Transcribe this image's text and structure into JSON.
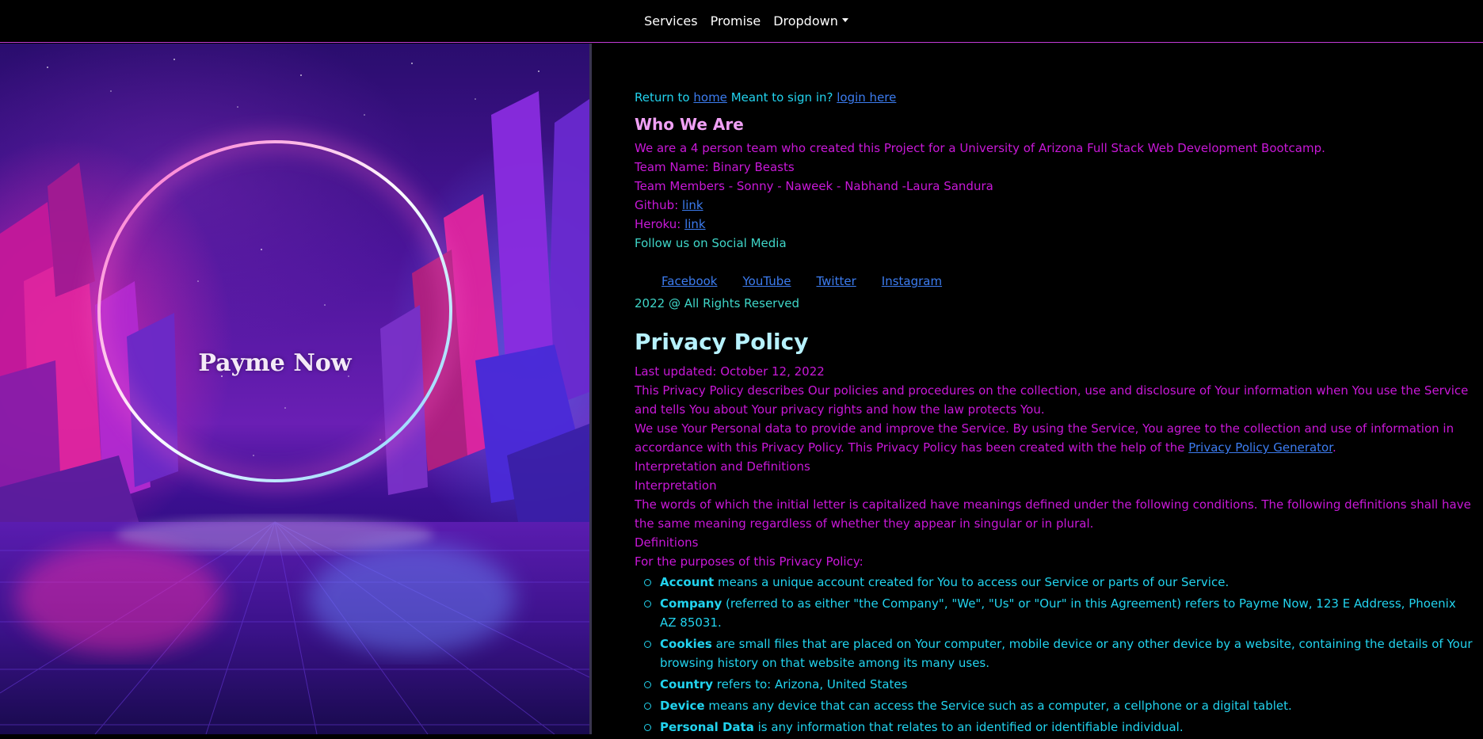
{
  "nav": {
    "items": [
      "Services",
      "Promise",
      "Dropdown"
    ]
  },
  "hero": {
    "title": "Payme Now"
  },
  "intro": {
    "return_to": "Return to",
    "home_link": "home",
    "meant_to": "Meant to sign in?",
    "login_link": "login here"
  },
  "who": {
    "title": "Who We Are",
    "description": "We are a 4 person team who created this Project for a University of Arizona Full Stack Web Development Bootcamp.",
    "team_name": "Team Name: Binary Beasts",
    "team_members": "Team Members - Sonny - Naweek - Nabhand -Laura Sandura",
    "github_label": "Github:",
    "github_link": "link",
    "heroku_label": "Heroku:",
    "heroku_link": "link",
    "follow": "Follow us on Social Media",
    "social": [
      "Facebook",
      "YouTube",
      "Twitter",
      "Instagram"
    ],
    "rights": "2022 @ All Rights Reserved"
  },
  "privacy": {
    "title": "Privacy Policy",
    "last_updated": "Last updated: October 12, 2022",
    "p1": "This Privacy Policy describes Our policies and procedures on the collection, use and disclosure of Your information when You use the Service and tells You about Your privacy rights and how the law protects You.",
    "p2_a": "We use Your Personal data to provide and improve the Service. By using the Service, You agree to the collection and use of information in accordance with this Privacy Policy. This Privacy Policy has been created with the help of the",
    "p2_link": "Privacy Policy Generator",
    "p2_b": ".",
    "interp_defs": "Interpretation and Definitions",
    "interp": "Interpretation",
    "p3": "The words of which the initial letter is capitalized have meanings defined under the following conditions. The following definitions shall have the same meaning regardless of whether they appear in singular or in plural.",
    "definitions": "Definitions",
    "purposes": "For the purposes of this Privacy Policy:",
    "items": [
      {
        "term": "Account",
        "text": " means a unique account created for You to access our Service or parts of our Service."
      },
      {
        "term": "Company",
        "text": " (referred to as either \"the Company\", \"We\", \"Us\" or \"Our\" in this Agreement) refers to Payme Now, 123 E Address, Phoenix AZ 85031."
      },
      {
        "term": "Cookies",
        "text": " are small files that are placed on Your computer, mobile device or any other device by a website, containing the details of Your browsing history on that website among its many uses."
      },
      {
        "term": "Country",
        "text": " refers to: Arizona, United States"
      },
      {
        "term": "Device",
        "text": " means any device that can access the Service such as a computer, a cellphone or a digital tablet."
      },
      {
        "term": "Personal Data",
        "text": " is any information that relates to an identified or identifiable individual."
      }
    ]
  }
}
